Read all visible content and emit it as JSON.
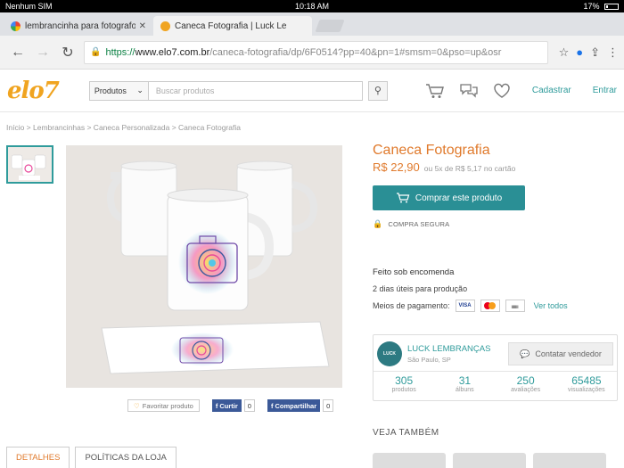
{
  "status_bar": {
    "carrier": "Nenhum SIM",
    "time": "10:18 AM",
    "battery": "17%"
  },
  "tabs": [
    {
      "title": "lembrancinha para fotografo",
      "active": false
    },
    {
      "title": "Caneca Fotografia | Luck Le",
      "active": true
    }
  ],
  "address_bar": {
    "scheme": "https://",
    "host": "www.elo7.com.br",
    "path": "/caneca-fotografia/dp/6F0514?pp=40&pn=1#smsm=0&pso=up&osr"
  },
  "site": {
    "logo": "elo7",
    "search_select": "Produtos",
    "search_placeholder": "Buscar produtos",
    "signup": "Cadastrar",
    "login": "Entrar"
  },
  "breadcrumb": "Início > Lembrancinhas > Caneca Personalizada > Caneca Fotografia",
  "product": {
    "title": "Caneca Fotografia",
    "price": "R$ 22,90",
    "installments": "ou 5x de R$ 5,17 no cartão",
    "buy_label": "Comprar este produto",
    "secure_label": "COMPRA SEGURA",
    "made_to_order": "Feito sob encomenda",
    "production_time": "2 dias úteis para produção",
    "payment_label": "Meios de pagamento:",
    "see_all": "Ver todos",
    "cards": [
      "VISA",
      "Mastercard",
      "Boleto"
    ]
  },
  "image_actions": {
    "favorite": "Favoritar produto",
    "curtir": "Curtir",
    "curtir_count": "0",
    "share": "Compartilhar",
    "share_count": "0"
  },
  "seller": {
    "logo_text": "LUCK",
    "name": "LUCK LEMBRANÇAS",
    "location": "São Paulo, SP",
    "contact": "Contatar vendedor",
    "stats": [
      {
        "value": "305",
        "label": "produtos"
      },
      {
        "value": "31",
        "label": "álbuns"
      },
      {
        "value": "250",
        "label": "avaliações"
      },
      {
        "value": "65485",
        "label": "visualizações"
      }
    ]
  },
  "see_also": "VEJA TAMBÉM",
  "page_tabs": [
    {
      "label": "DETALHES",
      "active": true
    },
    {
      "label": "POLÍTICAS DA LOJA",
      "active": false
    }
  ],
  "colors": {
    "accent_orange": "#e07a2c",
    "teal": "#2a8f95",
    "logo": "#f0a420",
    "facebook": "#3b5998"
  }
}
